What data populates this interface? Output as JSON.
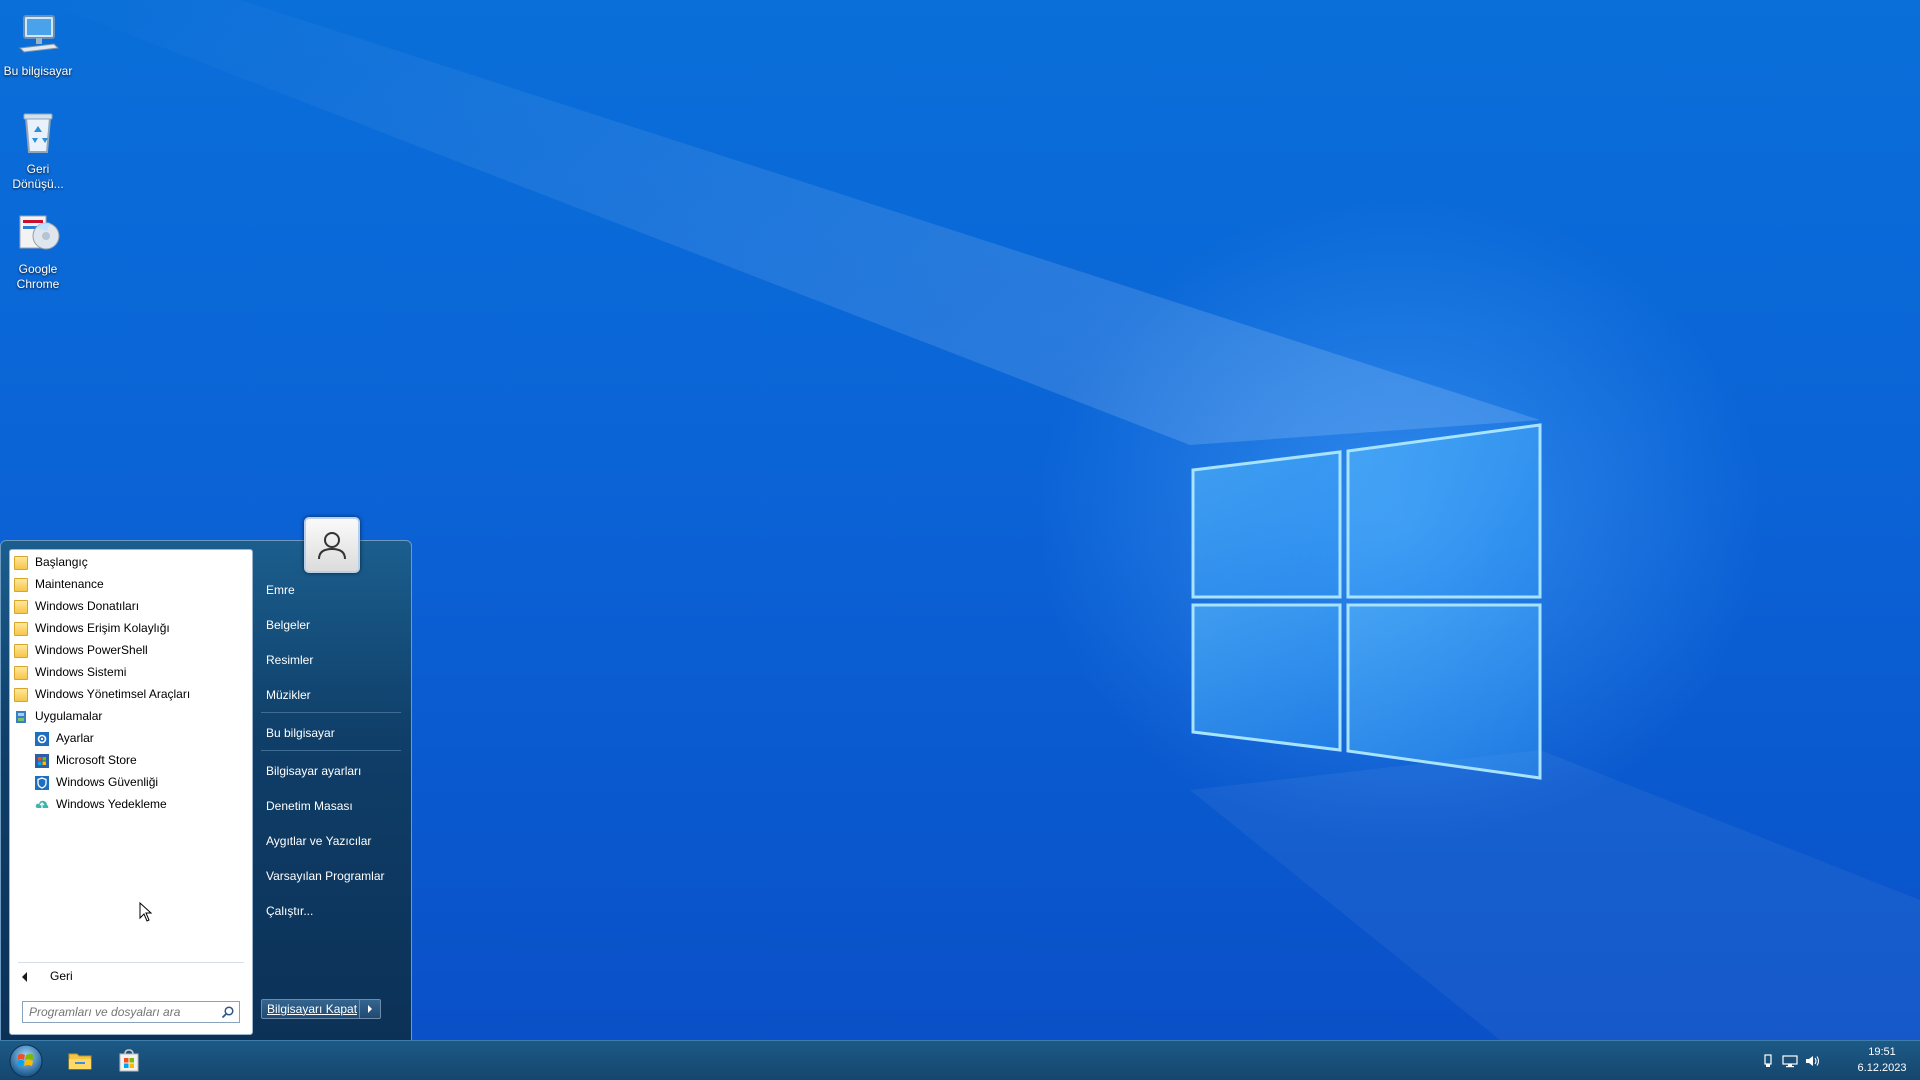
{
  "desktop": {
    "icons": [
      {
        "label": "Bu bilgisayar",
        "icon": "computer-icon"
      },
      {
        "label": "Geri Dönüşü...",
        "icon": "recycle-bin-icon"
      },
      {
        "label": "Google Chrome",
        "icon": "chrome-installer-icon"
      }
    ]
  },
  "start_menu": {
    "programs": [
      {
        "label": "Başlangıç",
        "icon": "folder-icon"
      },
      {
        "label": "Maintenance",
        "icon": "folder-icon"
      },
      {
        "label": "Windows Donatıları",
        "icon": "folder-icon"
      },
      {
        "label": "Windows Erişim Kolaylığı",
        "icon": "folder-icon"
      },
      {
        "label": "Windows PowerShell",
        "icon": "folder-icon"
      },
      {
        "label": "Windows Sistemi",
        "icon": "folder-icon"
      },
      {
        "label": "Windows Yönetimsel Araçları",
        "icon": "folder-icon"
      },
      {
        "label": "Uygulamalar",
        "icon": "apps-folder-icon"
      }
    ],
    "apps": [
      {
        "label": "Ayarlar",
        "icon": "settings-icon"
      },
      {
        "label": "Microsoft Store",
        "icon": "store-icon"
      },
      {
        "label": "Windows Güvenliği",
        "icon": "shield-icon"
      },
      {
        "label": "Windows Yedekleme",
        "icon": "backup-icon"
      }
    ],
    "back_label": "Geri",
    "search_placeholder": "Programları ve dosyaları ara",
    "right_links_group1": [
      "Emre",
      "Belgeler",
      "Resimler",
      "Müzikler"
    ],
    "right_links_group2": [
      "Bu bilgisayar"
    ],
    "right_links_group3": [
      "Bilgisayar ayarları",
      "Denetim Masası",
      "Aygıtlar ve Yazıcılar",
      "Varsayılan Programlar",
      "Çalıştır..."
    ],
    "shutdown_label": "Bilgisayarı Kapat"
  },
  "taskbar": {
    "pinned": [
      {
        "icon": "file-explorer-icon"
      },
      {
        "icon": "store-icon"
      }
    ],
    "time": "19:51",
    "date": "6.12.2023"
  },
  "colors": {
    "desktop_blue": "#0b63d6",
    "start_panel": "#0f3e68",
    "taskbar": "#15466e"
  }
}
